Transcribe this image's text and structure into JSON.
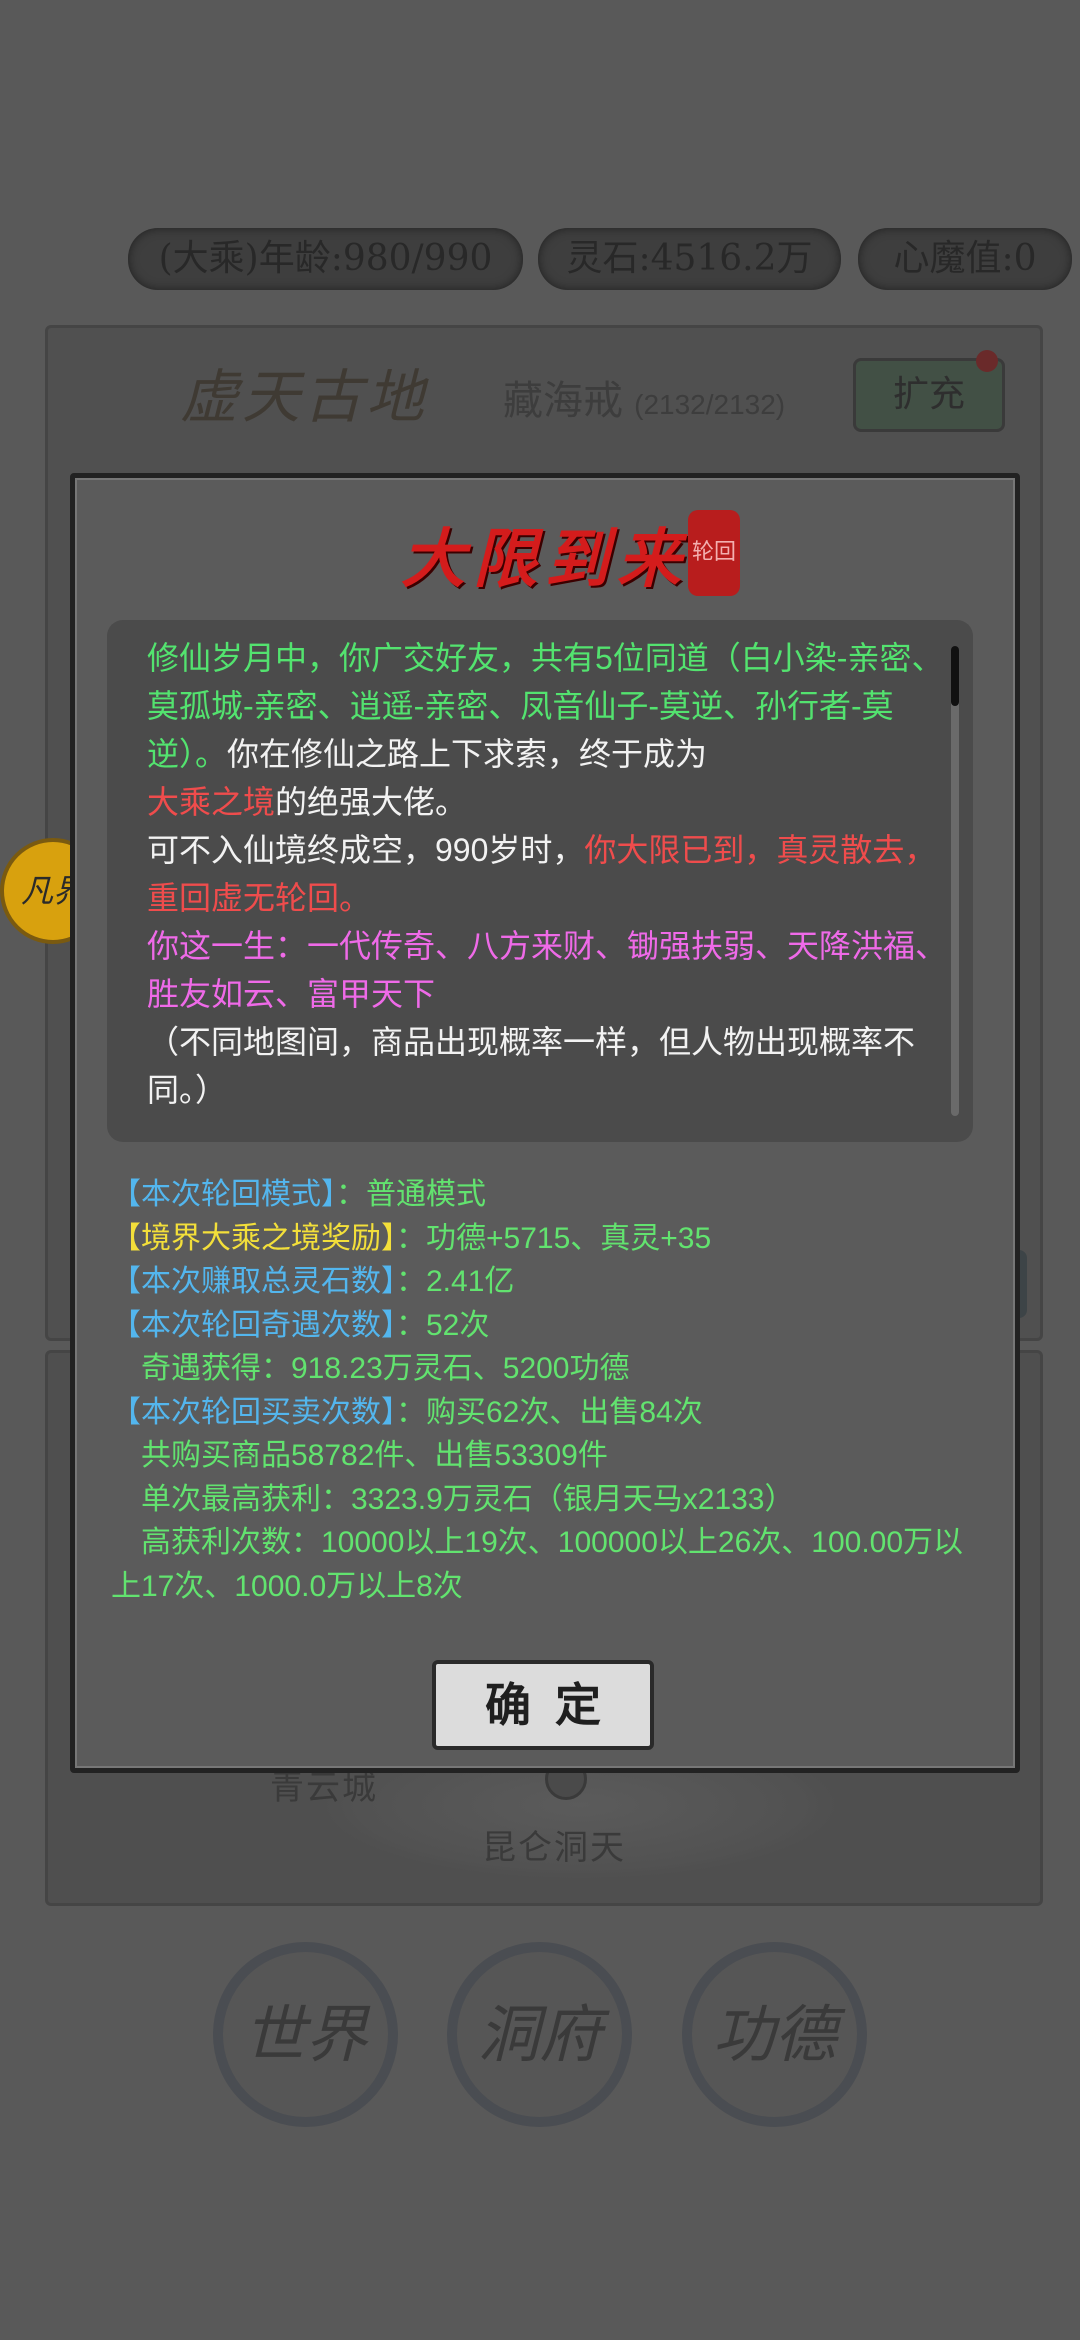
{
  "top_stats": {
    "age": "(大乘)年龄:980/990",
    "spirit_stone": "灵石:4516.2万",
    "demon_value": "心魔值:0"
  },
  "background": {
    "region_title": "虚天古地",
    "bag_title": "藏海戒",
    "bag_count": "(2132/2132)",
    "expand_button": "扩充",
    "map_labels": {
      "kunlun": "昆仑洞天",
      "qingyun": "青云城"
    },
    "side_badge": "凡界"
  },
  "bottom_nav": {
    "world": "世界",
    "cave": "洞府",
    "merit": "功德"
  },
  "modal": {
    "title": "大限到来",
    "seal": "轮回",
    "story": {
      "p1": "修仙岁月中，你广交好友，共有5位同道（白小染-亲密、莫孤城-亲密、逍遥-亲密、凤音仙子-莫逆、孙行者-莫逆）。",
      "p1b": "你在修仙之路上下求索，终于成为",
      "p1_realm": "大乘之境",
      "p1c": "的绝强大佬。",
      "p2a": "可不入仙境终成空，990岁时，",
      "p2_red": "你大限已到，真灵散去，重回虚无轮回。",
      "p3": "你这一生：一代传奇、八方来财、锄强扶弱、天降洪福、胜友如云、富甲天下",
      "p4": "（不同地图间，商品出现概率一样，但人物出现概率不同。）"
    },
    "stats": {
      "mode_label": "【本次轮回模式】",
      "mode_value": "：普通模式",
      "reward_label": "【境界大乘之境奖励】",
      "reward_value": "：功德+5715、真灵+35",
      "earn_label": "【本次赚取总灵石数】",
      "earn_value": "：2.41亿",
      "encounter_label": "【本次轮回奇遇次数】",
      "encounter_value": "：52次",
      "encounter_gain": "奇遇获得：918.23万灵石、5200功德",
      "trade_label": "【本次轮回买卖次数】",
      "trade_value": "：购买62次、出售84次",
      "trade_goods": "共购买商品58782件、出售53309件",
      "max_profit": "单次最高获利：3323.9万灵石（银月天马x2133）",
      "high_profit": "高获利次数：10000以上19次、100000以上26次、100.00万以上17次、1000.0万以上8次"
    },
    "confirm_button": "确定"
  }
}
